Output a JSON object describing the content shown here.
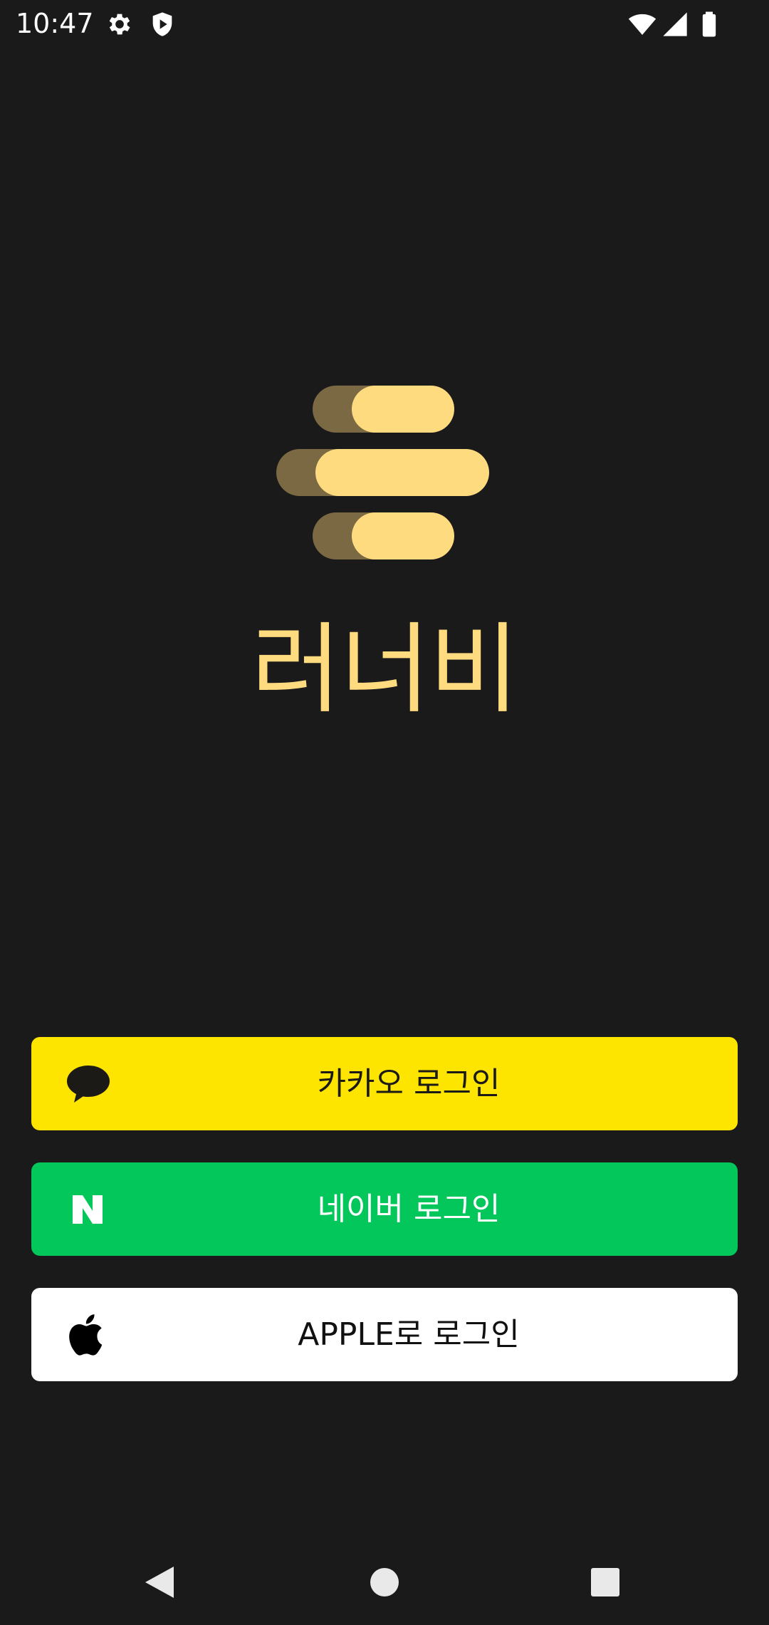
{
  "status_bar": {
    "time": "10:47",
    "icons": [
      "settings-icon",
      "shield-play-icon",
      "wifi-icon",
      "cellular-icon",
      "battery-icon"
    ]
  },
  "app": {
    "logo_icon": "bee-stripes-logo",
    "title": "러너비",
    "brand_color": "#ffdb80"
  },
  "login": {
    "kakao": {
      "label": "카카오 로그인",
      "icon": "kakao-talk-icon",
      "color": "#fee500"
    },
    "naver": {
      "label": "네이버 로그인",
      "icon": "naver-n-icon",
      "color": "#03c75a"
    },
    "apple": {
      "label": "APPLE로 로그인",
      "icon": "apple-icon",
      "color": "#ffffff"
    }
  },
  "nav_bar": {
    "icons": [
      "back-icon",
      "home-icon",
      "recents-icon"
    ]
  }
}
